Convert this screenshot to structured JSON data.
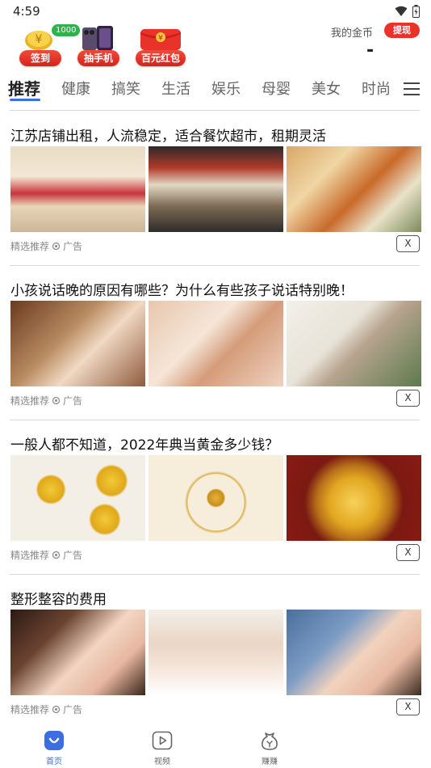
{
  "status": {
    "time": "4:59"
  },
  "promo": {
    "checkin": {
      "label": "签到",
      "coin_badge": "1000元"
    },
    "phone_draw": {
      "label": "抽手机"
    },
    "red_packet": {
      "label": "百元红包"
    }
  },
  "wallet": {
    "label": "我的金币",
    "withdraw_label": "提现",
    "value": "-"
  },
  "tabs": [
    {
      "label": "推荐",
      "active": true
    },
    {
      "label": "健康"
    },
    {
      "label": "搞笑"
    },
    {
      "label": "生活"
    },
    {
      "label": "娱乐"
    },
    {
      "label": "母婴"
    },
    {
      "label": "美女"
    },
    {
      "label": "时尚"
    }
  ],
  "feed": [
    {
      "title": "江苏店铺出租，人流稳定，适合餐饮超市，租期灵活",
      "source": "精选推荐",
      "tag": "广告",
      "close": "X"
    },
    {
      "title": "小孩说话晚的原因有哪些？为什么有些孩子说话特别晚！",
      "source": "精选推荐",
      "tag": "广告",
      "close": "X"
    },
    {
      "title": "一般人都不知道，2022年典当黄金多少钱？",
      "source": "精选推荐",
      "tag": "广告",
      "close": "X"
    },
    {
      "title": "整形整容的费用",
      "source": "精选推荐",
      "tag": "广告",
      "close": "X"
    }
  ],
  "bottom_nav": [
    {
      "label": "首页",
      "icon": "home-icon",
      "active": true
    },
    {
      "label": "视频",
      "icon": "video-icon"
    },
    {
      "label": "赚赚",
      "icon": "earn-icon"
    }
  ],
  "colors": {
    "accent": "#3b6de3",
    "red": "#e8322a",
    "badge_green": "#2fb24c"
  }
}
